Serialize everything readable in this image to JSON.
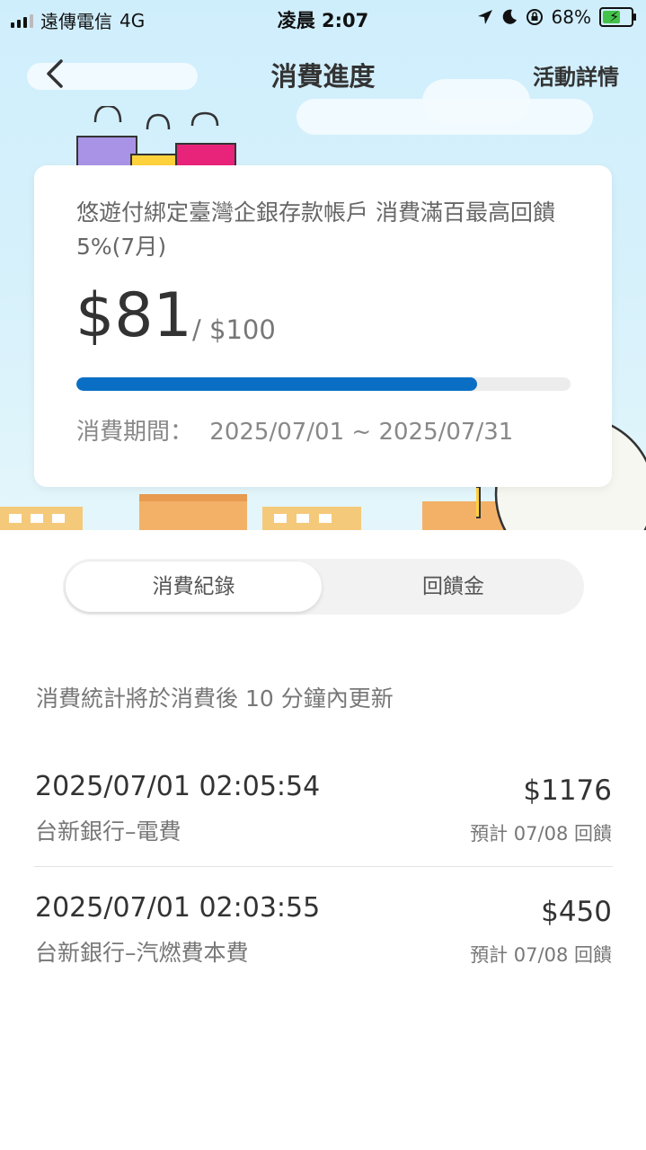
{
  "status_bar": {
    "carrier": "遠傳電信",
    "network": "4G",
    "time": "凌晨 2:07",
    "battery_pct": "68%",
    "battery_level": 0.68
  },
  "navbar": {
    "title": "消費進度",
    "action": "活動詳情"
  },
  "card": {
    "title": "悠遊付綁定臺灣企銀存款帳戶 消費滿百最高回饋5%(7月)",
    "amount": "$81",
    "target": "/ $100",
    "progress": 0.81,
    "progress_color": "#0a6fc4",
    "period_label": "消費期間：",
    "period_value": "2025/07/01 ~ 2025/07/31"
  },
  "tabs": [
    {
      "label": "消費紀錄",
      "active": true
    },
    {
      "label": "回饋金",
      "active": false
    }
  ],
  "notice": "消費統計將於消費後 10 分鐘內更新",
  "transactions": [
    {
      "datetime": "2025/07/01 02:05:54",
      "merchant": "台新銀行–電費",
      "amount": "$1176",
      "eta": "預計 07/08 回饋"
    },
    {
      "datetime": "2025/07/01 02:03:55",
      "merchant": "台新銀行–汽燃費本費",
      "amount": "$450",
      "eta": "預計 07/08 回饋"
    }
  ],
  "icons": {
    "back": "chevron-left-icon",
    "location": "location-arrow-icon",
    "moon": "moon-icon",
    "lock": "rotation-lock-icon",
    "battery": "battery-charging-icon"
  }
}
